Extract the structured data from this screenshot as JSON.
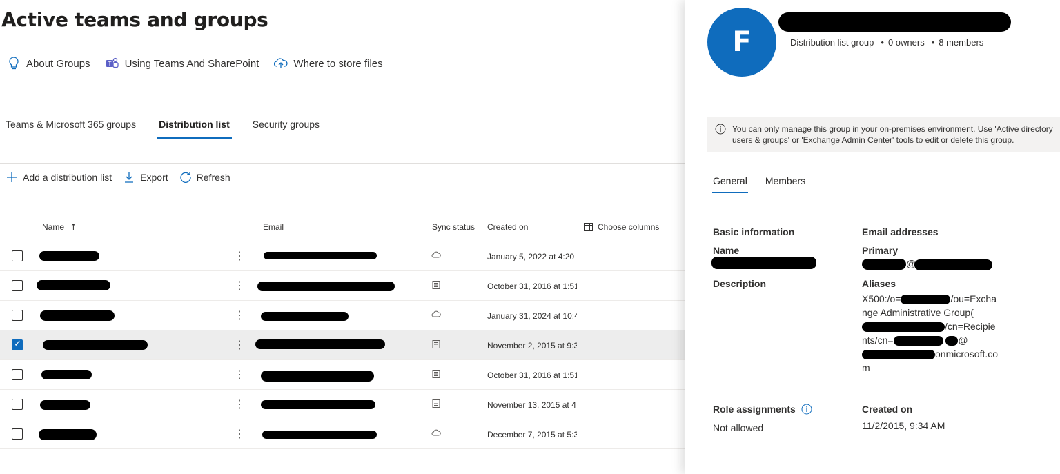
{
  "page": {
    "title": "Active teams and groups"
  },
  "links": [
    {
      "icon": "lightbulb-icon",
      "label": "About Groups"
    },
    {
      "icon": "teams-icon",
      "label": "Using Teams And SharePoint"
    },
    {
      "icon": "cloud-upload-icon",
      "label": "Where to store files"
    }
  ],
  "tabs": [
    {
      "label": "Teams & Microsoft 365 groups",
      "active": false
    },
    {
      "label": "Distribution list",
      "active": true
    },
    {
      "label": "Security groups",
      "active": false
    }
  ],
  "toolbar": {
    "add_label": "Add a distribution list",
    "export_label": "Export",
    "refresh_label": "Refresh"
  },
  "table": {
    "columns": {
      "name": "Name",
      "email": "Email",
      "sync": "Sync status",
      "created": "Created on",
      "choose": "Choose columns"
    },
    "rows": [
      {
        "sync": "cloud",
        "created": "January 5, 2022 at 4:20 P",
        "checked": false
      },
      {
        "sync": "onprem",
        "created": "October 31, 2016 at 1:51",
        "checked": false
      },
      {
        "sync": "cloud",
        "created": "January 31, 2024 at 10:4",
        "checked": false
      },
      {
        "sync": "onprem",
        "created": "November 2, 2015 at 9:3",
        "checked": true
      },
      {
        "sync": "onprem",
        "created": "October 31, 2016 at 1:51",
        "checked": false
      },
      {
        "sync": "onprem",
        "created": "November 13, 2015 at 4",
        "checked": false
      },
      {
        "sync": "cloud",
        "created": "December 7, 2015 at 5:3",
        "checked": false
      }
    ]
  },
  "panel": {
    "avatar_letter": "F",
    "group_type": "Distribution list group",
    "owners": "0 owners",
    "members": "8 members",
    "info_text": "You can only manage this group in your on-premises environment. Use 'Active directory users & groups' or 'Exchange Admin Center' tools to edit or delete this group.",
    "tabs": [
      "General",
      "Members"
    ],
    "basic_info": "Basic information",
    "name_label": "Name",
    "description_label": "Description",
    "email_addresses": "Email addresses",
    "primary_label": "Primary",
    "aliases_label": "Aliases",
    "alias_parts": {
      "a": "X500:/o=",
      "b": "/ou=Exchange Administrative Group",
      "c": "(",
      "d": "/cn=Recipients/cn=",
      "e": "@",
      "f": "onmicrosoft.com"
    },
    "primary_at": "@",
    "role_assignments_label": "Role assignments",
    "role_assignments_value": "Not allowed",
    "created_on_label": "Created on",
    "created_on_value": "11/2/2015, 9:34 AM"
  }
}
